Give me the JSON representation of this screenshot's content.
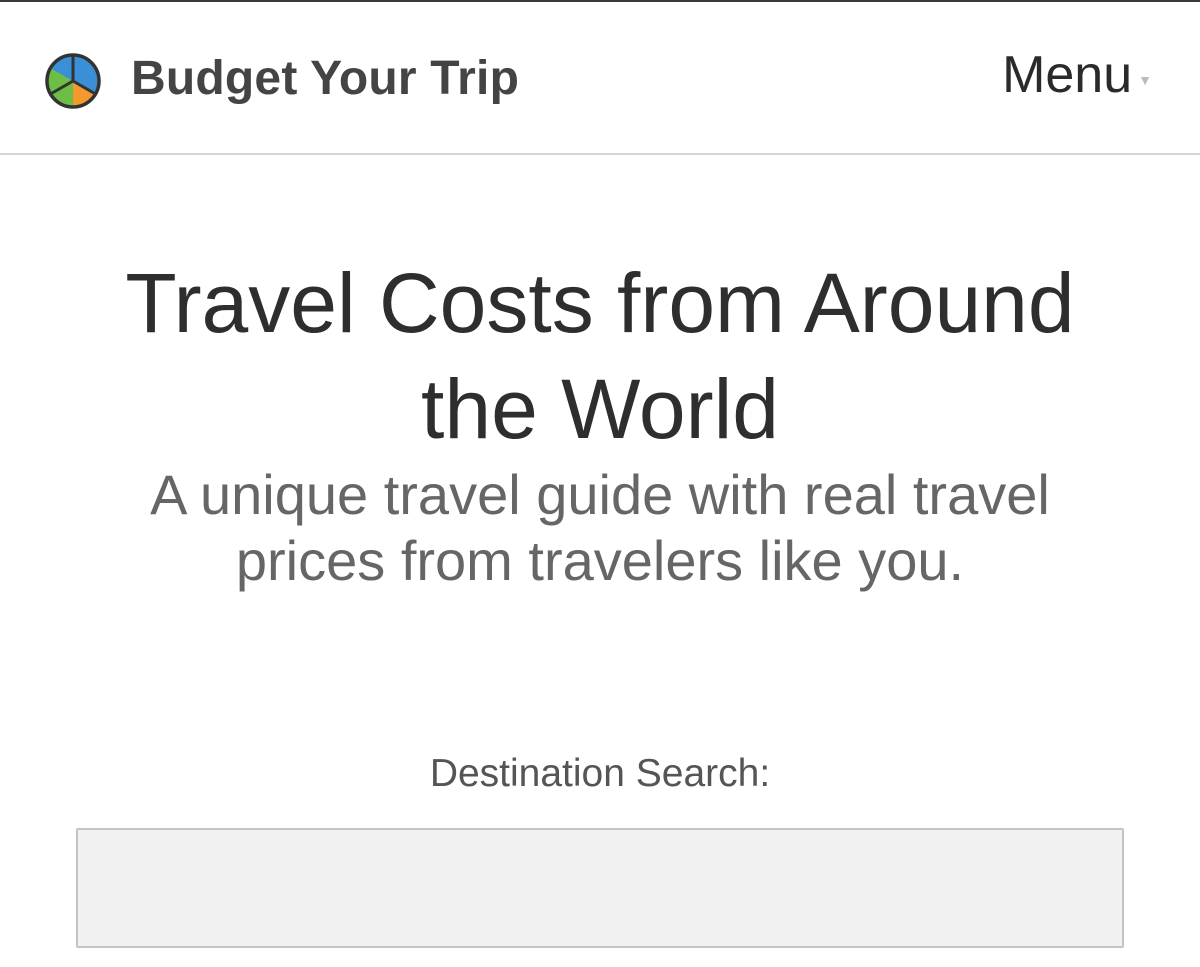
{
  "header": {
    "brand": "Budget Your Trip",
    "menu_label": "Menu",
    "logo_icon": "pie-chart-logo-icon",
    "menu_caret_icon": "caret-down-icon",
    "logo_colors": {
      "blue": "#3b8fd6",
      "orange": "#f29a2e",
      "green": "#6cbf44",
      "outline": "#333333"
    }
  },
  "hero": {
    "title_line1": "Travel Costs from Around",
    "title_line2": "the World",
    "subtitle_line1": "A unique travel guide with real travel",
    "subtitle_line2": "prices from travelers like you."
  },
  "search": {
    "label": "Destination Search:",
    "value": "",
    "placeholder": ""
  }
}
